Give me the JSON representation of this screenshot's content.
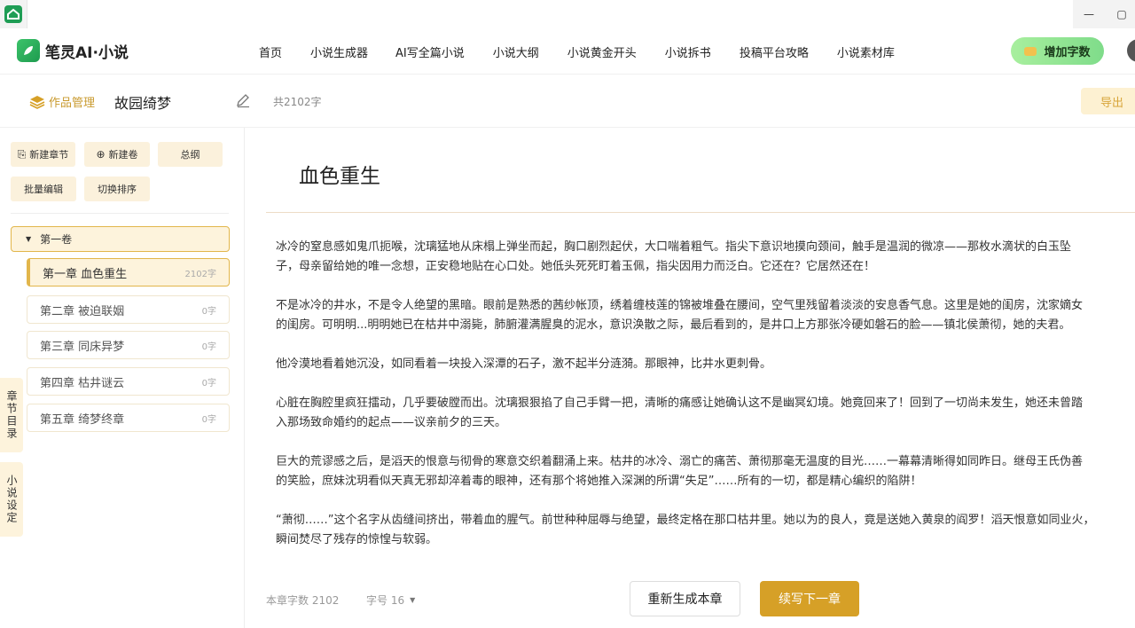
{
  "window": {
    "icon": "home-icon",
    "controls": {
      "minimize": "—",
      "maximize": "▢"
    }
  },
  "nav": {
    "logo_text": "笔灵AI·小说",
    "links": [
      "首页",
      "小说生成器",
      "AI写全篇小说",
      "小说大纲",
      "小说黄金开头",
      "小说拆书",
      "投稿平台攻略",
      "小说素材库"
    ],
    "add_words_label": "增加字数"
  },
  "workbar": {
    "works_mgmt_label": "作品管理",
    "book_title": "故园绮梦",
    "word_total": "共2102字",
    "export_label": "导出"
  },
  "sidebar": {
    "tools": {
      "new_chapter": "新建章节",
      "new_volume": "新建卷",
      "outline": "总纲",
      "batch_edit": "批量编辑",
      "switch_sort": "切换排序"
    },
    "volume_label": "第一卷",
    "chapters": [
      {
        "title": "第一章 血色重生",
        "count": "2102字"
      },
      {
        "title": "第二章 被迫联姻",
        "count": "0字"
      },
      {
        "title": "第三章 同床异梦",
        "count": "0字"
      },
      {
        "title": "第四章 枯井谜云",
        "count": "0字"
      },
      {
        "title": "第五章 绮梦终章",
        "count": "0字"
      }
    ],
    "side_tabs": {
      "chapter_dir": "章节目录",
      "novel_settings": "小说设定"
    }
  },
  "content": {
    "chapter_title": "血色重生",
    "paragraphs": [
      [
        "冰冷的窒息感如鬼爪扼喉，沈璃猛地从床榻上弹坐而起，胸口剧烈起伏，大口喘着粗气。指尖下意识地摸向颈间，触手是温润的微凉——那枚水滴状的白玉坠",
        "子，母亲留给她的唯一念想，正安稳地贴在心口处。她低头死死盯着玉佩，指尖因用力而泛白。它还在？它居然还在！"
      ],
      [
        "不是冰冷的井水，不是令人绝望的黑暗。眼前是熟悉的茜纱帐顶，绣着缠枝莲的锦被堆叠在腰间，空气里残留着淡淡的安息香气息。这里是她的闺房，沈家嫡女",
        "的闺房。可明明...明明她已在枯井中溺毙，肺腑灌满腥臭的泥水，意识涣散之际，最后看到的，是井口上方那张冷硬如磐石的脸——镇北侯萧彻，她的夫君。"
      ],
      [
        "他冷漠地看着她沉没，如同看着一块投入深潭的石子，激不起半分涟漪。那眼神，比井水更刺骨。"
      ],
      [
        "心脏在胸腔里疯狂擂动，几乎要破膛而出。沈璃狠狠掐了自己手臂一把，清晰的痛感让她确认这不是幽冥幻境。她竟回来了！回到了一切尚未发生，她还未曾踏",
        "入那场致命婚约的起点——议亲前夕的三天。"
      ],
      [
        "巨大的荒谬感之后，是滔天的恨意与彻骨的寒意交织着翻涌上来。枯井的冰冷、溺亡的痛苦、萧彻那毫无温度的目光……一幕幕清晰得如同昨日。继母王氏伪善",
        "的笑脸，庶妹沈玥看似天真无邪却淬着毒的眼神，还有那个将她推入深渊的所谓“失足”……所有的一切，都是精心编织的陷阱！"
      ],
      [
        "“萧彻……”这个名字从齿缝间挤出，带着血的腥气。前世种种屈辱与绝望，最终定格在那口枯井里。她以为的良人，竟是送她入黄泉的阎罗！滔天恨意如同业火，",
        "瞬间焚尽了残存的惊惶与软弱。"
      ]
    ]
  },
  "bottom": {
    "chapter_count": "本章字数 2102",
    "font_size": "字号 16",
    "regen_label": "重新生成本章",
    "next_label": "续写下一章"
  },
  "colors": {
    "accent": "#d6a027",
    "accent_light": "#fdf3dc",
    "green": "#7fdc8a"
  }
}
